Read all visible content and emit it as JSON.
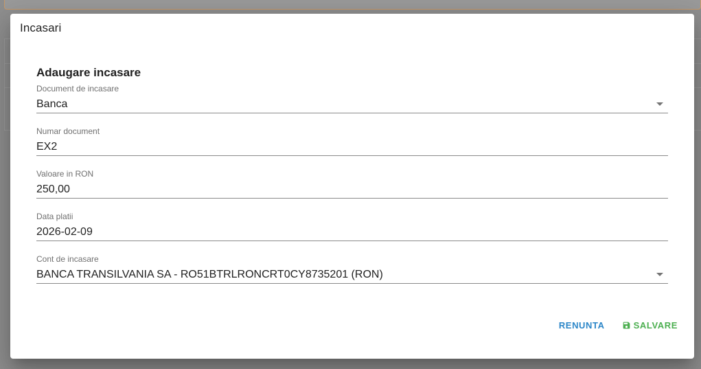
{
  "dialog": {
    "title": "Incasari"
  },
  "form": {
    "heading": "Adaugare incasare",
    "fields": [
      {
        "label": "Document de incasare",
        "value": "Banca"
      },
      {
        "label": "Numar document",
        "value": "EX2"
      },
      {
        "label": "Valoare in RON",
        "value": "250,00"
      },
      {
        "label": "Data platii",
        "value": "2026-02-09"
      },
      {
        "label": "Cont de incasare",
        "value": "BANCA TRANSILVANIA SA - RO51BTRLRONCRT0CY8735201 (RON)"
      }
    ]
  },
  "actions": {
    "cancel_label": "RENUNTA",
    "save_label": "SALVARE",
    "save_icon": "floppy-disk-icon"
  },
  "colors": {
    "cancel": "#2b86c8",
    "save": "#4caf50"
  }
}
